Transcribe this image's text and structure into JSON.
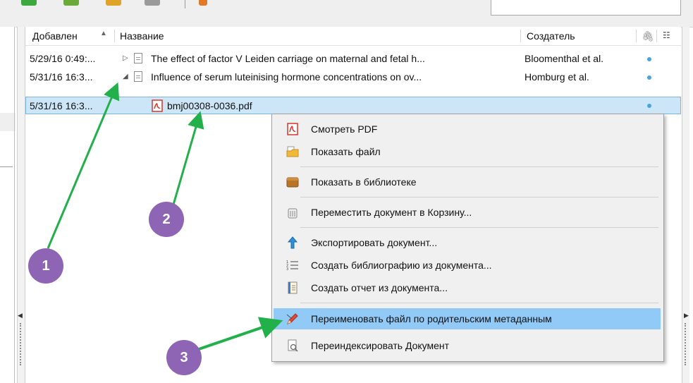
{
  "list": {
    "columns": {
      "added": "Добавлен",
      "title": "Название",
      "creator": "Создатель"
    },
    "rows": [
      {
        "added": "5/29/16 0:49:...",
        "title": "The effect of factor V Leiden carriage on maternal and fetal h...",
        "creator": "Bloomenthal et al.",
        "expanded": false
      },
      {
        "added": "5/31/16 16:3...",
        "title": "Influence of serum luteinising hormone concentrations on ov...",
        "creator": "Homburg et al.",
        "expanded": true
      },
      {
        "added": "5/31/16 16:3...",
        "title": "bmj00308-0036.pdf",
        "creator": "",
        "selected": true
      }
    ]
  },
  "context_menu": {
    "items": [
      {
        "label": "Смотреть PDF",
        "icon": "pdf-icon"
      },
      {
        "label": "Показать файл",
        "icon": "folder-icon"
      },
      {
        "label": "Показать в библиотеке",
        "icon": "library-icon"
      },
      {
        "label": "Переместить документ в Корзину...",
        "icon": "trash-icon"
      },
      {
        "label": "Экспортировать документ...",
        "icon": "export-arrow-icon"
      },
      {
        "label": "Создать библиографию из документа...",
        "icon": "numbered-list-icon"
      },
      {
        "label": "Создать отчет из документа...",
        "icon": "report-icon"
      },
      {
        "label": "Переименовать файл по родительским метаданным",
        "icon": "rename-pencil-icon",
        "highlighted": true
      },
      {
        "label": "Переиндексировать Документ",
        "icon": "reindex-icon"
      }
    ]
  },
  "annotations": {
    "badge_1": "1",
    "badge_2": "2",
    "badge_3": "3",
    "arrow_color": "#22b04a",
    "badge_color": "#8e64b5"
  },
  "colors": {
    "selection": "#cde6f7",
    "menu_highlight": "#91c9f7",
    "attachment_dot": "#4aa3df"
  }
}
